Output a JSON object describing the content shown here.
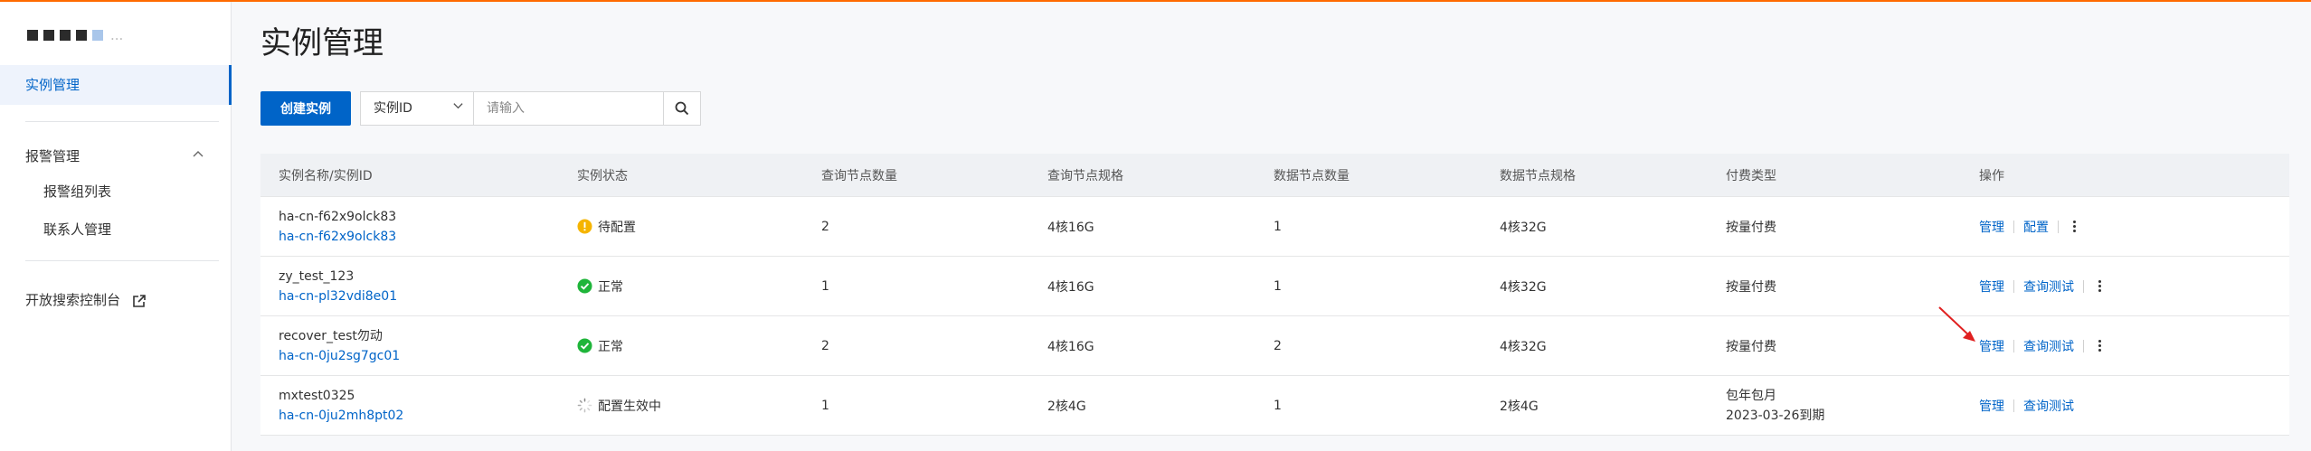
{
  "sidebar": {
    "brand_text": "...",
    "active_item": "实例管理",
    "group_label": "报警管理",
    "group_items": [
      "报警组列表",
      "联系人管理"
    ],
    "external_link": "开放搜索控制台"
  },
  "page": {
    "title": "实例管理",
    "create_button": "创建实例",
    "filter_select": "实例ID",
    "search_placeholder": "请输入"
  },
  "colors": {
    "primary": "#0064c8",
    "warning": "#f5b400",
    "success": "#1fb53a",
    "accent_top": "#ff6a00"
  },
  "table": {
    "headers": [
      "实例名称/实例ID",
      "实例状态",
      "查询节点数量",
      "查询节点规格",
      "数据节点数量",
      "数据节点规格",
      "付费类型",
      "操作"
    ],
    "rows": [
      {
        "name": "ha-cn-f62x9olck83",
        "id": "ha-cn-f62x9olck83",
        "status": "待配置",
        "status_icon": "warning-icon",
        "query_nodes": "2",
        "query_spec": "4核16G",
        "data_nodes": "1",
        "data_spec": "4核32G",
        "billing": "按量付费",
        "billing2": "",
        "op1": "管理",
        "op2": "配置"
      },
      {
        "name": "zy_test_123",
        "id": "ha-cn-pl32vdi8e01",
        "status": "正常",
        "status_icon": "check-icon",
        "query_nodes": "1",
        "query_spec": "4核16G",
        "data_nodes": "1",
        "data_spec": "4核32G",
        "billing": "按量付费",
        "billing2": "",
        "op1": "管理",
        "op2": "查询测试"
      },
      {
        "name": "recover_test勿动",
        "id": "ha-cn-0ju2sg7gc01",
        "status": "正常",
        "status_icon": "check-icon",
        "query_nodes": "2",
        "query_spec": "4核16G",
        "data_nodes": "2",
        "data_spec": "4核32G",
        "billing": "按量付费",
        "billing2": "",
        "op1": "管理",
        "op2": "查询测试"
      },
      {
        "name": "mxtest0325",
        "id": "ha-cn-0ju2mh8pt02",
        "status": "配置生效中",
        "status_icon": "loading-icon",
        "query_nodes": "1",
        "query_spec": "2核4G",
        "data_nodes": "1",
        "data_spec": "2核4G",
        "billing": "包年包月",
        "billing2": "2023-03-26到期",
        "op1": "管理",
        "op2": "查询测试"
      }
    ]
  }
}
